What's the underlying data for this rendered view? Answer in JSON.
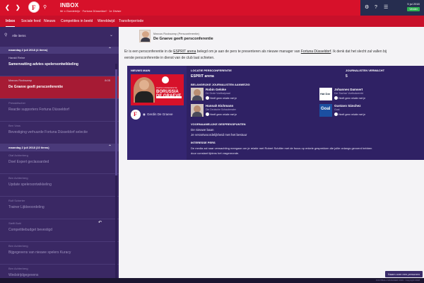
{
  "header": {
    "back_icon": "chevron-left-icon",
    "forward_icon": "chevron-right-icon",
    "search_icon": "search-icon",
    "title": "INBOX",
    "subtitle": "Mr x Goedeleijn · Fortuna Düsseldorf · 1e Divisie",
    "date_day": "5 jul 2018",
    "continue_label": "Verder",
    "colors": {
      "primary": "#d7112a",
      "dark": "#262d4f",
      "continue": "#30b152"
    }
  },
  "tabs": [
    {
      "label": "Inbox",
      "active": true
    },
    {
      "label": "Sociale feed"
    },
    {
      "label": "Nieuws"
    },
    {
      "label": "Competities in beeld"
    },
    {
      "label": "Wereldwijd"
    },
    {
      "label": "Transferperiode"
    }
  ],
  "sidebar": {
    "filter_label": "Alle items",
    "groups": [
      {
        "label": "maandag 2 juli 2018 (4 items)",
        "messages": [
          {
            "sender": "Harald Reine",
            "subject": "Samenvatting advies spelersontwikkeling",
            "time": "",
            "state": "normal"
          },
          {
            "sender": "Marcus Rocksamp",
            "subject": "De Graeve geeft persconferentie",
            "time": "8:05",
            "state": "selected"
          },
          {
            "sender": "Presskitscher",
            "subject": "Reactie supporters Fortuna Düsseldorf",
            "time": "",
            "state": "dim"
          },
          {
            "sender": "Ben Voss",
            "subject": "Bevestiging verhuurde Fortuna Düsseldorf selectie",
            "time": "",
            "state": "dim"
          }
        ]
      },
      {
        "label": "maandag 2 juli 2018 (10 items)",
        "messages": [
          {
            "sender": "Olaf Achterberg",
            "subject": "Doel Expert geclassarded",
            "time": "",
            "state": "dim"
          },
          {
            "sender": "Ben Achterberg",
            "subject": "Update spelersontwikkeling",
            "time": "",
            "state": "dim"
          },
          {
            "sender": "Rolf Scherter",
            "subject": "Trainer Lijkbeoordeling",
            "time": "",
            "state": "dim"
          },
          {
            "sender": "Steffi Bohl",
            "subject": "Competitiebudget bevestigd",
            "time": "",
            "state": "dim",
            "reply": true
          },
          {
            "sender": "Ben Achterberg",
            "subject": "Bijgegevens van nieuwe spelers Kuracy",
            "time": "",
            "state": "dim"
          },
          {
            "sender": "Ben Achterberg",
            "subject": "Wedstrijdgegevens",
            "time": "",
            "state": "dim"
          }
        ]
      }
    ]
  },
  "message": {
    "sender": "Marcus Rocksamp (Persconferentie)",
    "subject": "De Graeve geeft persconferentie",
    "body_prefix": "Er is een persconferentie in de ",
    "body_venue": "ESPRIT arena",
    "body_middle": " belegd om je aan de pers te presenteren als nieuwe manager van ",
    "body_club": "Fortuna Düsseldorf",
    "body_suffix": ". Ik denk dat het slecht zal vallen bij",
    "body_line2": "eerste persconferentie in dienst van de club laat schieten.",
    "card": {
      "news_label": "NIEUWS MAIN",
      "news_image": {
        "tag": "PERSCONFERENTIE",
        "name_line1": "BORUSSIA",
        "name_line2": "DE GRAEVE"
      },
      "source_label": "Gerdin De Graeve",
      "location_label": "LOCATIE PERSCONFERENTIE",
      "location_value": "ESPRIT arena",
      "journalists_count_label": "JOURNALISTEN VERWACHT",
      "journalists_count_value": "5",
      "journalists_label": "BELANGRIJKE JOURNALISTEN AANWEZIG",
      "journalists": [
        {
          "name": "Robin Geloke",
          "org": "De Grote Voetbalpraat",
          "chip": "Heeft geen relatie met je",
          "pic": "face"
        },
        {
          "name": "Johannes Damsert",
          "org": "Der Sachse Voetbalwereld",
          "chip": "Heeft geen relatie met je",
          "pic": "hat"
        },
        {
          "name": "Hannah Eichmann",
          "org": "Die Deutsche Schauberater",
          "chip": "Heeft geen relatie met je",
          "pic": "face"
        },
        {
          "name": "Gustavo Sánchez",
          "org": "Goal",
          "chip": "Heeft geen relatie met je",
          "pic": "goal"
        }
      ],
      "questions_label": "VOORNAAMELIJKE GESPREKSPUNTEN",
      "questions": [
        "De nieuwe baan",
        "Je verantwoordelijkheid met het bestuur"
      ],
      "press_label": "INTERESSE PERS",
      "press_text_1": "De media zal naar verwachting meegaan om je relatie met Robert Schäfer met de focus op enkele gesprekken die jullie onlangs gevoerd hebben",
      "press_text_2": "duur constant tijdens het vragenronde."
    },
    "more_button": "Naam over een personen"
  },
  "statusbar": "FOOTBALL MANAGER 2019 - Copyright 2018"
}
